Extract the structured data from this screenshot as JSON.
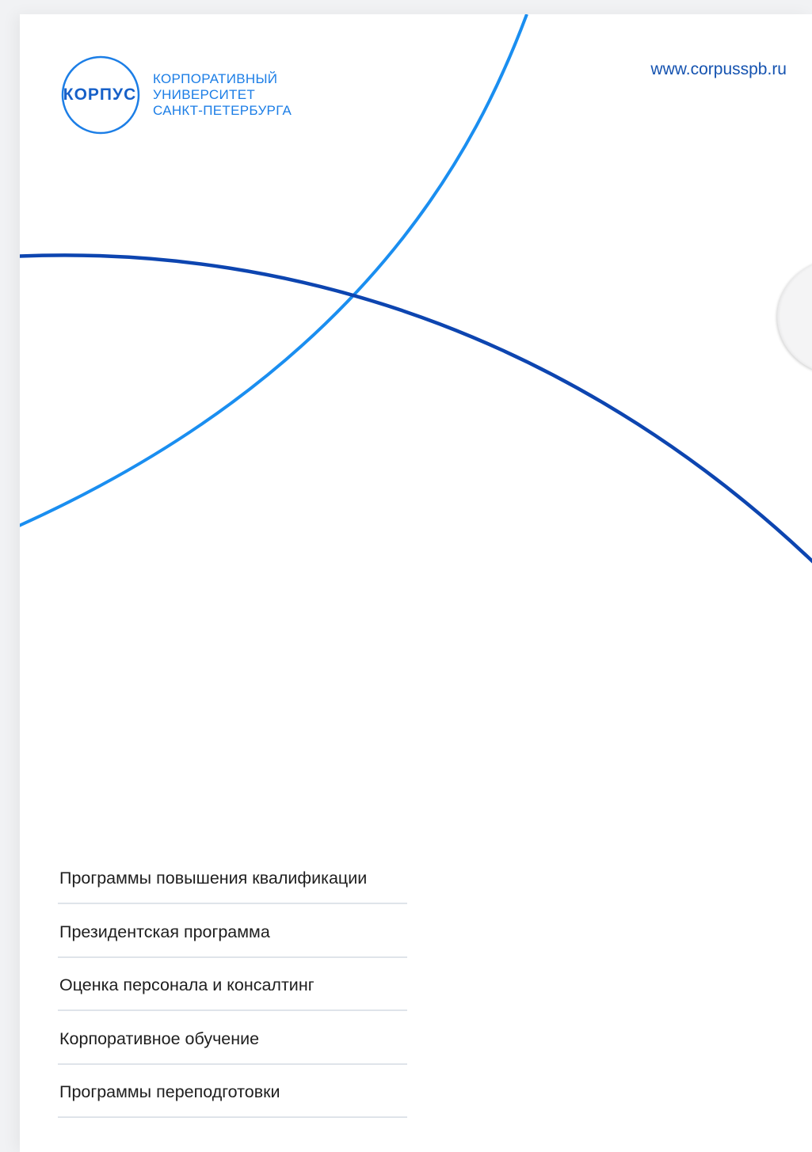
{
  "logo": {
    "wordmark": "КОРПУС",
    "lines": [
      "КОРПОРАТИВНЫЙ",
      "УНИВЕРСИТЕТ",
      "САНКТ-ПЕТЕРБУРГА"
    ]
  },
  "website": "www.corpusspb.ru",
  "services": [
    "Программы повышения квалификации",
    "Президентская программа",
    "Оценка персонала и консалтинг",
    "Корпоративное обучение",
    "Программы переподготовки"
  ],
  "colors": {
    "brand_blue": "#1760c8",
    "light_blue": "#1a8ef0",
    "dark_blue": "#0d45b0",
    "link_blue": "#1553b0"
  }
}
